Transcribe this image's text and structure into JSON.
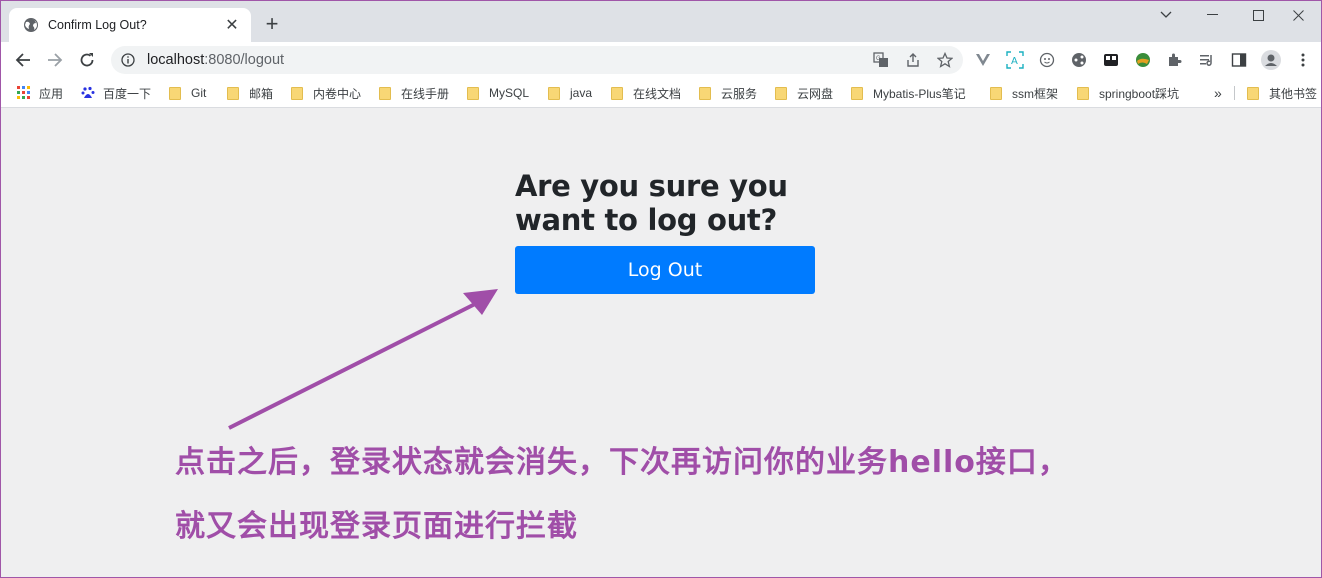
{
  "tab": {
    "title": "Confirm Log Out?"
  },
  "omnibox": {
    "host": "localhost",
    "path": ":8080/logout"
  },
  "bookmarks": [
    {
      "label": "应用",
      "icon": "apps-grid-icon"
    },
    {
      "label": "百度一下",
      "icon": "baidu-icon"
    },
    {
      "label": "Git",
      "icon": "folder-icon"
    },
    {
      "label": "邮箱",
      "icon": "folder-icon"
    },
    {
      "label": "内卷中心",
      "icon": "folder-icon"
    },
    {
      "label": "在线手册",
      "icon": "folder-icon"
    },
    {
      "label": "MySQL",
      "icon": "folder-icon"
    },
    {
      "label": "java",
      "icon": "folder-icon"
    },
    {
      "label": "在线文档",
      "icon": "folder-icon"
    },
    {
      "label": "云服务",
      "icon": "folder-icon"
    },
    {
      "label": "云网盘",
      "icon": "folder-icon"
    },
    {
      "label": "Mybatis-Plus笔记",
      "icon": "folder-icon"
    },
    {
      "label": "ssm框架",
      "icon": "folder-icon"
    },
    {
      "label": "springboot踩坑",
      "icon": "folder-icon"
    },
    {
      "label": "»",
      "icon": ""
    },
    {
      "label": "其他书签",
      "icon": "folder-icon"
    }
  ],
  "page": {
    "heading_line1": "Are you sure you",
    "heading_line2": "want to log out?",
    "button_label": "Log Out",
    "button_color": "#007bff"
  },
  "annotation": {
    "line1": "点击之后，登录状态就会消失，下次再访问你的业务hello接口，",
    "line2": "就又会出现登录页面进行拦截",
    "color": "#a04ea8"
  }
}
